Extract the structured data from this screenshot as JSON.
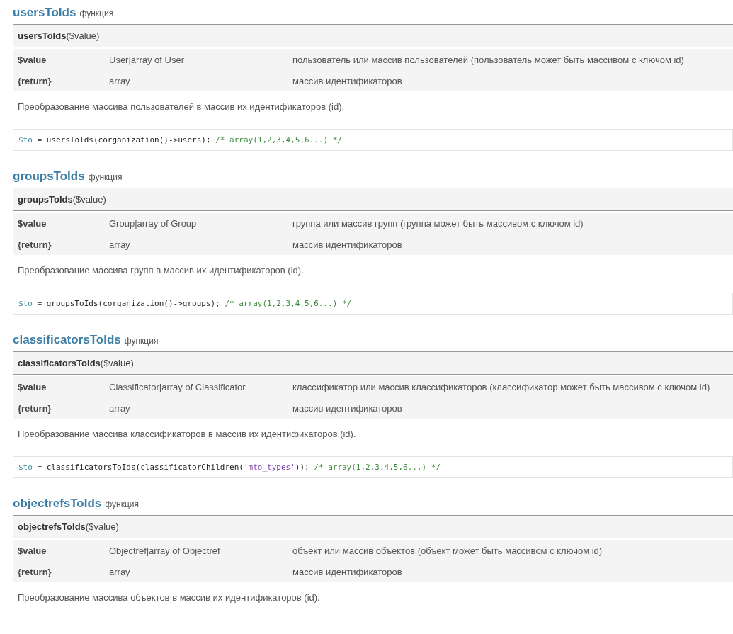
{
  "sections": [
    {
      "name": "usersToIds",
      "kind_label": "функция",
      "signature": {
        "name": "usersToIds",
        "args": "($value)"
      },
      "params": [
        {
          "name": "$value",
          "type": "User|array of User",
          "description": "пользователь или массив пользователей (пользователь может быть массивом с ключом id)"
        },
        {
          "name": "{return}",
          "type": "array",
          "description": "массив идентификаторов"
        }
      ],
      "description": "Преобразование массива пользователей в массив их идентификаторов (id).",
      "code": [
        {
          "kind": "var",
          "text": "$to"
        },
        {
          "kind": "op",
          "text": " = "
        },
        {
          "kind": "plain",
          "text": "usersToIds(corganization()->users); "
        },
        {
          "kind": "comment",
          "text": "/* array(1,2,3,4,5,6...) */"
        }
      ]
    },
    {
      "name": "groupsToIds",
      "kind_label": "функция",
      "signature": {
        "name": "groupsToIds",
        "args": "($value)"
      },
      "params": [
        {
          "name": "$value",
          "type": "Group|array of Group",
          "description": "группа или массив групп (группа может быть массивом с ключом id)"
        },
        {
          "name": "{return}",
          "type": "array",
          "description": "массив идентификаторов"
        }
      ],
      "description": "Преобразование массива групп в массив их идентификаторов (id).",
      "code": [
        {
          "kind": "var",
          "text": "$to"
        },
        {
          "kind": "op",
          "text": " = "
        },
        {
          "kind": "plain",
          "text": "groupsToIds(corganization()->groups); "
        },
        {
          "kind": "comment",
          "text": "/* array(1,2,3,4,5,6...) */"
        }
      ]
    },
    {
      "name": "classificatorsToIds",
      "kind_label": "функция",
      "signature": {
        "name": "classificatorsToIds",
        "args": "($value)"
      },
      "params": [
        {
          "name": "$value",
          "type": "Classificator|array of Classificator",
          "description": "классификатор или массив классификаторов (классификатор может быть массивом с ключом id)"
        },
        {
          "name": "{return}",
          "type": "array",
          "description": "массив идентификаторов"
        }
      ],
      "description": "Преобразование массива классификаторов в массив их идентификаторов (id).",
      "code": [
        {
          "kind": "var",
          "text": "$to"
        },
        {
          "kind": "op",
          "text": " = "
        },
        {
          "kind": "plain",
          "text": "classificatorsToIds(classificatorChildren("
        },
        {
          "kind": "string",
          "text": "'mto_types'"
        },
        {
          "kind": "plain",
          "text": ")); "
        },
        {
          "kind": "comment",
          "text": "/* array(1,2,3,4,5,6...) */"
        }
      ]
    },
    {
      "name": "objectrefsToIds",
      "kind_label": "функция",
      "signature": {
        "name": "objectrefsToIds",
        "args": "($value)"
      },
      "params": [
        {
          "name": "$value",
          "type": "Objectref|array of Objectref",
          "description": "объект или массив объектов (объект может быть массивом с ключом id)"
        },
        {
          "name": "{return}",
          "type": "array",
          "description": "массив идентификаторов"
        }
      ],
      "description": "Преобразование массива объектов в массив их идентификаторов (id)."
    }
  ]
}
